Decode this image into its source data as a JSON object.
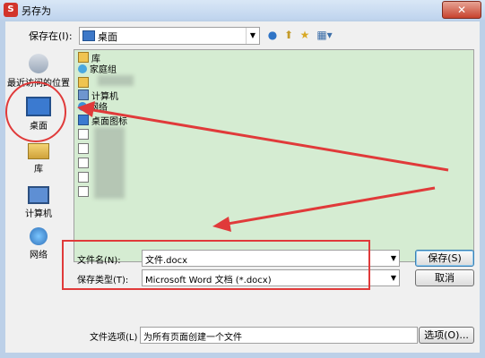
{
  "window": {
    "title": "另存为",
    "close_label": "✕"
  },
  "toolbar": {
    "save_in_label": "保存在(I):",
    "save_in_value": "桌面",
    "back_icon": "back-icon",
    "up_icon": "up-folder-icon",
    "new_folder_icon": "new-folder-icon",
    "views_icon": "views-icon"
  },
  "places": [
    {
      "label": "最近访问的位置",
      "icon": "recent-places-icon"
    },
    {
      "label": "桌面",
      "icon": "desktop-icon"
    },
    {
      "label": "库",
      "icon": "library-icon"
    },
    {
      "label": "计算机",
      "icon": "computer-icon"
    },
    {
      "label": "网络",
      "icon": "network-icon"
    }
  ],
  "files": [
    {
      "label": "库",
      "icon": "library-icon"
    },
    {
      "label": "家庭组",
      "icon": "homegroup-icon"
    },
    {
      "label": "",
      "icon": "folder-icon"
    },
    {
      "label": "计算机",
      "icon": "computer-icon"
    },
    {
      "label": "网络",
      "icon": "network-icon"
    },
    {
      "label": "桌面图标",
      "icon": "desktop-icon"
    }
  ],
  "form": {
    "filename_label": "文件名(N):",
    "filename_value": "文件.docx",
    "filetype_label": "保存类型(T):",
    "filetype_value": "Microsoft Word 文档 (*.docx)",
    "save_button": "保存(S)",
    "cancel_button": "取消",
    "options_label": "文件选项(L)",
    "options_value": "为所有页面创建一个文件",
    "options_button": "选项(O)..."
  },
  "colors": {
    "annotation_red": "#e03a3a",
    "filelist_bg": "#d5ecd2"
  }
}
